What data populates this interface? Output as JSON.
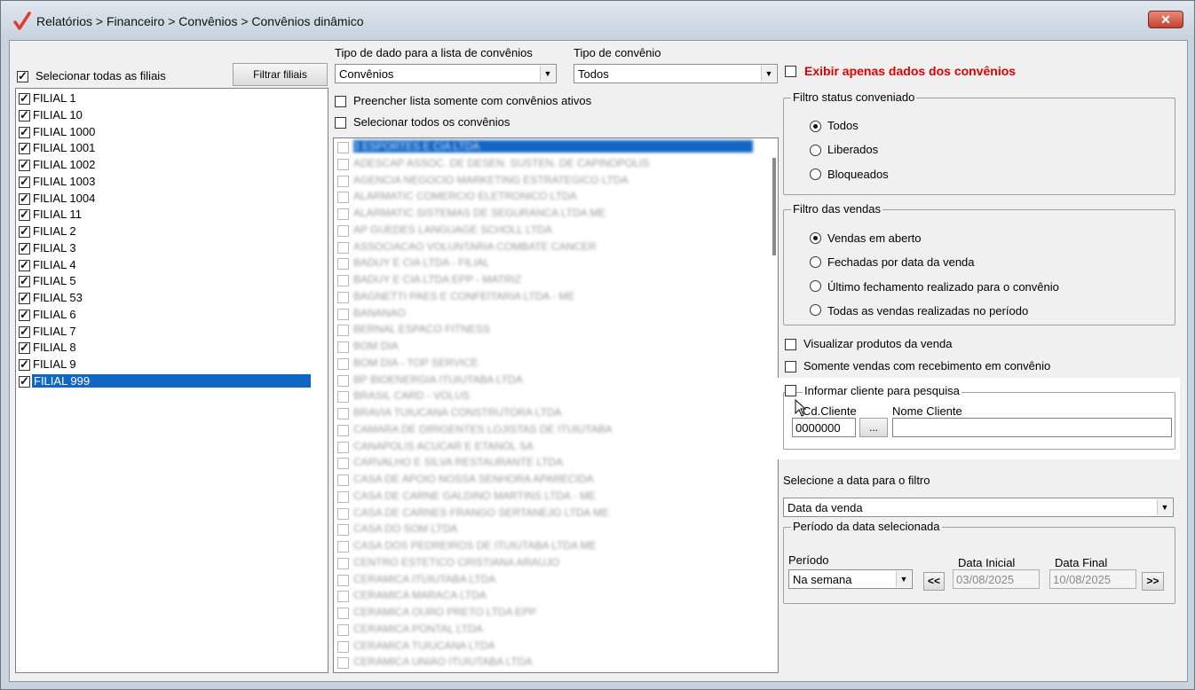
{
  "window": {
    "title": "Relatórios > Financeiro > Convênios > Convênios dinâmico",
    "close_label": "✕"
  },
  "filiais": {
    "select_all_label": "Selecionar todas as filiais",
    "filter_button": "Filtrar filiais",
    "items": [
      {
        "label": "FILIAL 1",
        "checked": true
      },
      {
        "label": "FILIAL 10",
        "checked": true
      },
      {
        "label": "FILIAL 1000",
        "checked": true
      },
      {
        "label": "FILIAL 1001",
        "checked": true
      },
      {
        "label": "FILIAL 1002",
        "checked": true
      },
      {
        "label": "FILIAL 1003",
        "checked": true
      },
      {
        "label": "FILIAL 1004",
        "checked": true
      },
      {
        "label": "FILIAL 11",
        "checked": true
      },
      {
        "label": "FILIAL 2",
        "checked": true
      },
      {
        "label": "FILIAL 3",
        "checked": true
      },
      {
        "label": "FILIAL 4",
        "checked": true
      },
      {
        "label": "FILIAL 5",
        "checked": true
      },
      {
        "label": "FILIAL 53",
        "checked": true
      },
      {
        "label": "FILIAL 6",
        "checked": true
      },
      {
        "label": "FILIAL 7",
        "checked": true
      },
      {
        "label": "FILIAL 8",
        "checked": true
      },
      {
        "label": "FILIAL 9",
        "checked": true
      },
      {
        "label": "FILIAL 999",
        "checked": true,
        "selected": true
      }
    ]
  },
  "convenios": {
    "tipo_dado_label": "Tipo de dado para a lista de convênios",
    "tipo_dado_value": "Convênios",
    "tipo_convenio_label": "Tipo de convênio",
    "tipo_convenio_value": "Todos",
    "only_active_label": "Preencher lista somente com convênios ativos",
    "select_all_label": "Selecionar todos os convênios",
    "items": [
      "3 ESPORTES E CIA LTDA",
      "ADESCAP ASSOC. DE DESEN. SUSTEN. DE CAPINOPOLIS",
      "AGENCIA NEGOCIO MARKETING ESTRATEGICO LTDA",
      "ALARMATIC COMERCIO ELETRONICO LTDA",
      "ALARMATIC SISTEMAS DE SEGURANCA LTDA ME",
      "AP GUEDES LANGUAGE SCHOLL LTDA",
      "ASSOCIACAO VOLUNTARIA COMBATE CANCER",
      "BADUY E CIA LTDA - FILIAL",
      "BADUY E CIA LTDA EPP - MATRIZ",
      "BAGNETTI PAES E CONFEITARIA LTDA - ME",
      "BANANAO",
      "BERNAL ESPACO FITNESS",
      "BOM DIA",
      "BOM DIA - TOP SERVICE",
      "BP BIOENERGIA ITUIUTABA LTDA",
      "BRASIL CARD - VOLUS",
      "BRAVIA TUIUCANA CONSTRUTORA LTDA",
      "CAMARA DE DIRIGENTES LOJISTAS DE ITUIUTABA",
      "CANAPOLIS ACUCAR E ETANOL SA",
      "CARVALHO E SILVA RESTAURANTE LTDA",
      "CASA DE APOIO NOSSA SENHORA APARECIDA",
      "CASA DE CARNE GALDINO MARTINS LTDA - ME",
      "CASA DE CARNES FRANGO SERTANEJO LTDA ME",
      "CASA DO SOM LTDA",
      "CASA DOS PEDREIROS DE ITUIUTABA LTDA ME",
      "CENTRO ESTETICO CRISTIANA ARAUJO",
      "CERAMICA ITUIUTABA LTDA",
      "CERAMICA MARACA LTDA",
      "CERAMICA OURO PRETO LTDA EPP",
      "CERAMICA PONTAL LTDA",
      "CERAMICA TUIUCANA LTDA",
      "CERAMICA UNIAO ITUIUTABA LTDA"
    ]
  },
  "right": {
    "exibir_label": "Exibir apenas dados dos convênios",
    "exibir_color": "#e00000",
    "status": {
      "legend": "Filtro status conveniado",
      "options": [
        "Todos",
        "Liberados",
        "Bloqueados"
      ],
      "selected": "Todos"
    },
    "vendas": {
      "legend": "Filtro das vendas",
      "options": [
        "Vendas em aberto",
        "Fechadas por data da venda",
        "Último fechamento realizado para o convênio",
        "Todas as vendas realizadas no período"
      ],
      "selected": "Vendas em aberto"
    },
    "visualizar_label": "Visualizar produtos da venda",
    "somente_label": "Somente vendas com recebimento em convênio",
    "cliente": {
      "legend": "Informar cliente para pesquisa",
      "cod_label": "Cd.Cliente",
      "cod_value": "0000000",
      "browse_label": "...",
      "nome_label": "Nome Cliente",
      "nome_value": ""
    },
    "data_filtro_label": "Selecione a data para o filtro",
    "data_filtro_value": "Data da venda",
    "periodo": {
      "legend": "Período da data selecionada",
      "periodo_label": "Período",
      "periodo_value": "Na semana",
      "prev_label": "<<",
      "next_label": ">>",
      "inicial_label": "Data Inicial",
      "inicial_value": "03/08/2025",
      "final_label": "Data Final",
      "final_value": "10/08/2025"
    }
  }
}
